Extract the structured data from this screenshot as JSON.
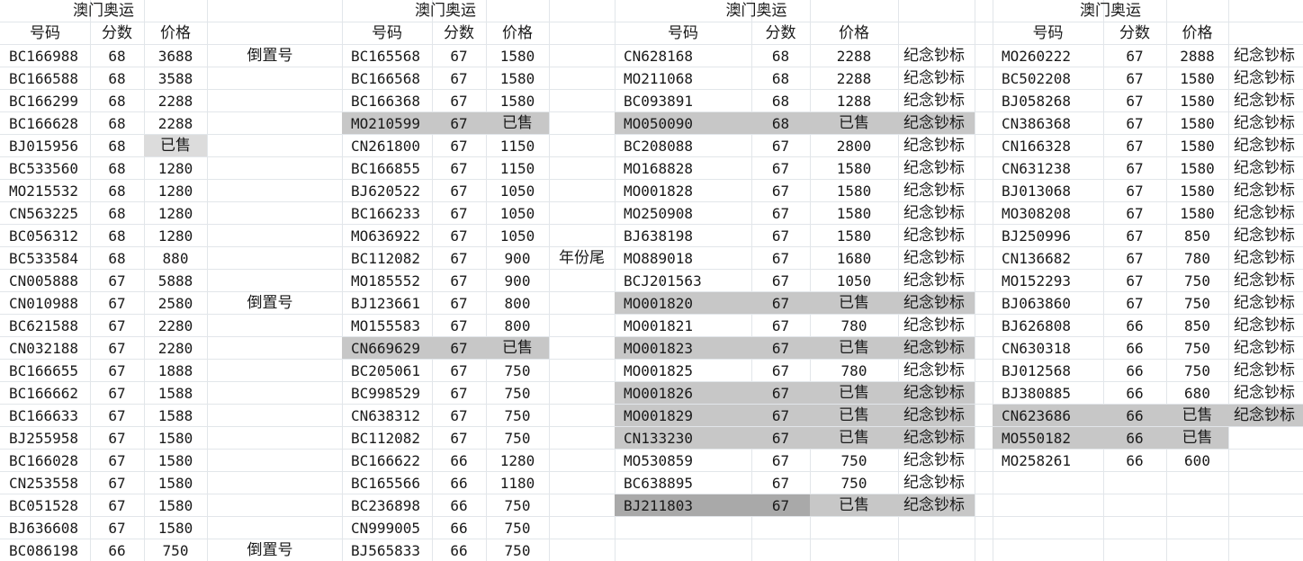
{
  "colors": {
    "sold_gray": "#c7c7c7",
    "sold_gray_medium": "#b7b7b7",
    "sold_gray_dark": "#a9a9a9",
    "sold_gray_light": "#dcdcdc",
    "grid": "#e2e6ea"
  },
  "tables": [
    {
      "title": "澳门奥运",
      "headers": [
        "号码",
        "分数",
        "价格"
      ],
      "side_notes": [
        {
          "row": 0,
          "text": "倒置号"
        },
        {
          "row": 11,
          "text": "倒置号"
        },
        {
          "row": 22,
          "text": "倒置号"
        }
      ],
      "rows": [
        {
          "code": "BC166988",
          "score": "68",
          "price": "3688"
        },
        {
          "code": "BC166588",
          "score": "68",
          "price": "3588"
        },
        {
          "code": "BC166299",
          "score": "68",
          "price": "2288"
        },
        {
          "code": "BC166628",
          "score": "68",
          "price": "2288"
        },
        {
          "code": "BJ015956",
          "score": "68",
          "price": "已售",
          "shade": "sold_gray_light",
          "shade_cols": [
            "price"
          ]
        },
        {
          "code": "BC533560",
          "score": "68",
          "price": "1280"
        },
        {
          "code": "MO215532",
          "score": "68",
          "price": "1280"
        },
        {
          "code": "CN563225",
          "score": "68",
          "price": "1280"
        },
        {
          "code": "BC056312",
          "score": "68",
          "price": "1280"
        },
        {
          "code": "BC533584",
          "score": "68",
          "price": "880"
        },
        {
          "code": "CN005888",
          "score": "67",
          "price": "5888"
        },
        {
          "code": "CN010988",
          "score": "67",
          "price": "2580"
        },
        {
          "code": "BC621588",
          "score": "67",
          "price": "2280"
        },
        {
          "code": "CN032188",
          "score": "67",
          "price": "2280"
        },
        {
          "code": "BC166655",
          "score": "67",
          "price": "1888"
        },
        {
          "code": "BC166662",
          "score": "67",
          "price": "1588"
        },
        {
          "code": "BC166633",
          "score": "67",
          "price": "1588"
        },
        {
          "code": "BJ255958",
          "score": "67",
          "price": "1580"
        },
        {
          "code": "BC166028",
          "score": "67",
          "price": "1580"
        },
        {
          "code": "CN253558",
          "score": "67",
          "price": "1580"
        },
        {
          "code": "BC051528",
          "score": "67",
          "price": "1580"
        },
        {
          "code": "BJ636608",
          "score": "67",
          "price": "1580"
        },
        {
          "code": "BC086198",
          "score": "66",
          "price": "750"
        }
      ]
    },
    {
      "title": "澳门奥运",
      "headers": [
        "号码",
        "分数",
        "价格"
      ],
      "side_notes": [
        {
          "row": 9,
          "text": "年份尾"
        }
      ],
      "rows": [
        {
          "code": "BC165568",
          "score": "67",
          "price": "1580"
        },
        {
          "code": "BC166568",
          "score": "67",
          "price": "1580"
        },
        {
          "code": "BC166368",
          "score": "67",
          "price": "1580"
        },
        {
          "code": "MO210599",
          "score": "67",
          "price": "已售",
          "shade": "sold_gray",
          "shade_cols": [
            "code",
            "score",
            "price"
          ]
        },
        {
          "code": "CN261800",
          "score": "67",
          "price": "1150"
        },
        {
          "code": "BC166855",
          "score": "67",
          "price": "1150"
        },
        {
          "code": "BJ620522",
          "score": "67",
          "price": "1050"
        },
        {
          "code": "BC166233",
          "score": "67",
          "price": "1050"
        },
        {
          "code": "MO636922",
          "score": "67",
          "price": "1050"
        },
        {
          "code": "BC112082",
          "score": "67",
          "price": "900"
        },
        {
          "code": "MO185552",
          "score": "67",
          "price": "900"
        },
        {
          "code": "BJ123661",
          "score": "67",
          "price": "800"
        },
        {
          "code": "MO155583",
          "score": "67",
          "price": "800"
        },
        {
          "code": "CN669629",
          "score": "67",
          "price": "已售",
          "shade": "sold_gray",
          "shade_cols": [
            "code",
            "score",
            "price"
          ]
        },
        {
          "code": "BC205061",
          "score": "67",
          "price": "750"
        },
        {
          "code": "BC998529",
          "score": "67",
          "price": "750"
        },
        {
          "code": "CN638312",
          "score": "67",
          "price": "750"
        },
        {
          "code": "BC112082",
          "score": "67",
          "price": "750"
        },
        {
          "code": "BC166622",
          "score": "66",
          "price": "1280"
        },
        {
          "code": "BC165566",
          "score": "66",
          "price": "1180"
        },
        {
          "code": "BC236898",
          "score": "66",
          "price": "750"
        },
        {
          "code": "CN999005",
          "score": "66",
          "price": "750"
        },
        {
          "code": "BJ565833",
          "score": "66",
          "price": "750"
        }
      ]
    },
    {
      "title": "澳门奥运",
      "headers": [
        "号码",
        "分数",
        "价格"
      ],
      "rows": [
        {
          "code": "CN628168",
          "score": "68",
          "price": "2288",
          "note": "纪念钞标"
        },
        {
          "code": "MO211068",
          "score": "68",
          "price": "2288",
          "note": "纪念钞标"
        },
        {
          "code": "BC093891",
          "score": "68",
          "price": "1288",
          "note": "纪念钞标"
        },
        {
          "code": "MO050090",
          "score": "68",
          "price": "已售",
          "note": "纪念钞标",
          "shade": "sold_gray",
          "shade_cols": [
            "code",
            "score",
            "price",
            "note"
          ]
        },
        {
          "code": "BC208088",
          "score": "67",
          "price": "2800",
          "note": "纪念钞标"
        },
        {
          "code": "MO168828",
          "score": "67",
          "price": "1580",
          "note": "纪念钞标"
        },
        {
          "code": "MO001828",
          "score": "67",
          "price": "1580",
          "note": "纪念钞标"
        },
        {
          "code": "MO250908",
          "score": "67",
          "price": "1580",
          "note": "纪念钞标"
        },
        {
          "code": "BJ638198",
          "score": "67",
          "price": "1580",
          "note": "纪念钞标"
        },
        {
          "code": "MO889018",
          "score": "67",
          "price": "1680",
          "note": "纪念钞标"
        },
        {
          "code": "BCJ201563",
          "score": "67",
          "price": "1050",
          "note": "纪念钞标"
        },
        {
          "code": "MO001820",
          "score": "67",
          "price": "已售",
          "note": "纪念钞标",
          "shade": "sold_gray",
          "shade_cols": [
            "code",
            "score",
            "price",
            "note"
          ]
        },
        {
          "code": "MO001821",
          "score": "67",
          "price": "780",
          "note": "纪念钞标"
        },
        {
          "code": "MO001823",
          "score": "67",
          "price": "已售",
          "note": "纪念钞标",
          "shade": "sold_gray",
          "shade_cols": [
            "code",
            "score",
            "price",
            "note"
          ]
        },
        {
          "code": "MO001825",
          "score": "67",
          "price": "780",
          "note": "纪念钞标"
        },
        {
          "code": "MO001826",
          "score": "67",
          "price": "已售",
          "note": "纪念钞标",
          "shade": "sold_gray",
          "shade_cols": [
            "code",
            "score",
            "price",
            "note"
          ]
        },
        {
          "code": "MO001829",
          "score": "67",
          "price": "已售",
          "note": "纪念钞标",
          "shade": "sold_gray",
          "shade_cols": [
            "code",
            "score",
            "price",
            "note"
          ]
        },
        {
          "code": "CN133230",
          "score": "67",
          "price": "已售",
          "note": "纪念钞标",
          "shade": "sold_gray",
          "shade_cols": [
            "code",
            "score",
            "price",
            "note"
          ]
        },
        {
          "code": "MO530859",
          "score": "67",
          "price": "750",
          "note": "纪念钞标"
        },
        {
          "code": "BC638895",
          "score": "67",
          "price": "750",
          "note": "纪念钞标"
        },
        {
          "code": "BJ211803",
          "score": "67",
          "price": "已售",
          "note": "纪念钞标",
          "shade": "sold_gray_dark",
          "shade_cols": [
            "code",
            "score"
          ],
          "shade2": "sold_gray",
          "shade2_cols": [
            "price",
            "note"
          ]
        }
      ]
    },
    {
      "title": "澳门奥运",
      "headers": [
        "号码",
        "分数",
        "价格"
      ],
      "rows": [
        {
          "code": "MO260222",
          "score": "67",
          "price": "2888",
          "note": "纪念钞标"
        },
        {
          "code": "BC502208",
          "score": "67",
          "price": "1580",
          "note": "纪念钞标"
        },
        {
          "code": "BJ058268",
          "score": "67",
          "price": "1580",
          "note": "纪念钞标"
        },
        {
          "code": "CN386368",
          "score": "67",
          "price": "1580",
          "note": "纪念钞标"
        },
        {
          "code": "CN166328",
          "score": "67",
          "price": "1580",
          "note": "纪念钞标"
        },
        {
          "code": "CN631238",
          "score": "67",
          "price": "1580",
          "note": "纪念钞标"
        },
        {
          "code": "BJ013068",
          "score": "67",
          "price": "1580",
          "note": "纪念钞标"
        },
        {
          "code": "MO308208",
          "score": "67",
          "price": "1580",
          "note": "纪念钞标"
        },
        {
          "code": "BJ250996",
          "score": "67",
          "price": "850",
          "note": "纪念钞标"
        },
        {
          "code": "CN136682",
          "score": "67",
          "price": "780",
          "note": "纪念钞标"
        },
        {
          "code": "MO152293",
          "score": "67",
          "price": "750",
          "note": "纪念钞标"
        },
        {
          "code": "BJ063860",
          "score": "67",
          "price": "750",
          "note": "纪念钞标"
        },
        {
          "code": "BJ626808",
          "score": "66",
          "price": "850",
          "note": "纪念钞标"
        },
        {
          "code": "CN630318",
          "score": "66",
          "price": "750",
          "note": "纪念钞标"
        },
        {
          "code": "BJ012568",
          "score": "66",
          "price": "750",
          "note": "纪念钞标"
        },
        {
          "code": "BJ380885",
          "score": "66",
          "price": "680",
          "note": "纪念钞标"
        },
        {
          "code": "CN623686",
          "score": "66",
          "price": "已售",
          "note": "纪念钞标",
          "shade": "sold_gray",
          "shade_cols": [
            "code",
            "score",
            "price",
            "note"
          ]
        },
        {
          "code": "MO550182",
          "score": "66",
          "price": "已售",
          "shade": "sold_gray",
          "shade_cols": [
            "code",
            "score",
            "price"
          ]
        },
        {
          "code": "MO258261",
          "score": "66",
          "price": "600"
        }
      ]
    }
  ]
}
